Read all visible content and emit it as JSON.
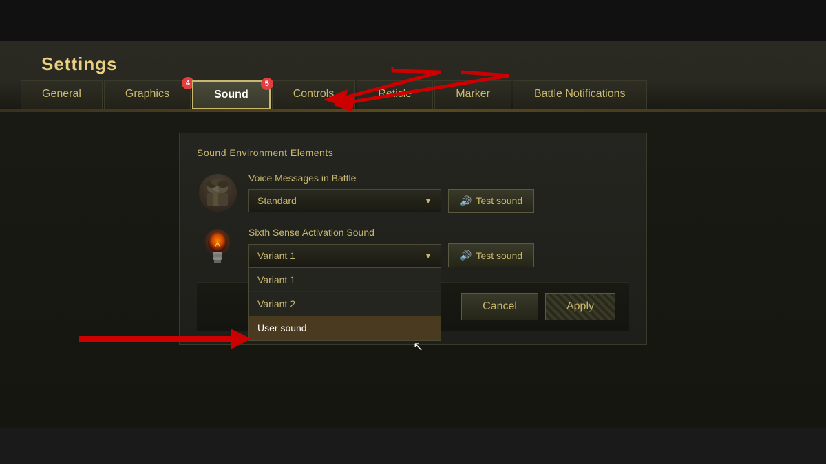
{
  "app": {
    "title": "Settings"
  },
  "tabs": [
    {
      "id": "general",
      "label": "General",
      "active": false,
      "badge": null
    },
    {
      "id": "graphics",
      "label": "Graphics",
      "active": false,
      "badge": "4"
    },
    {
      "id": "sound",
      "label": "Sound",
      "active": true,
      "badge": "5"
    },
    {
      "id": "controls",
      "label": "Controls",
      "active": false,
      "badge": null
    },
    {
      "id": "reticle",
      "label": "Reticle",
      "active": false,
      "badge": null
    },
    {
      "id": "marker",
      "label": "Marker",
      "active": false,
      "badge": null
    },
    {
      "id": "battle-notifications",
      "label": "Battle Notifications",
      "active": false,
      "badge": null
    }
  ],
  "sound_panel": {
    "title": "Sound Environment Elements",
    "voice_messages_label": "Voice Messages in Battle",
    "voice_messages_value": "Standard",
    "test_sound_label": "Test sound",
    "sixth_sense_label": "Sixth Sense Activation Sound",
    "sixth_sense_value": "Variant 1",
    "dropdown_options": [
      {
        "id": "variant1",
        "label": "Variant 1",
        "selected": true
      },
      {
        "id": "variant2",
        "label": "Variant 2",
        "selected": false
      },
      {
        "id": "user-sound",
        "label": "User sound",
        "selected": false,
        "highlighted": true
      }
    ]
  },
  "buttons": {
    "cancel_label": "Cancel",
    "apply_label": "Apply"
  },
  "icons": {
    "speaker": "🔊",
    "dropdown_arrow": "▼"
  }
}
